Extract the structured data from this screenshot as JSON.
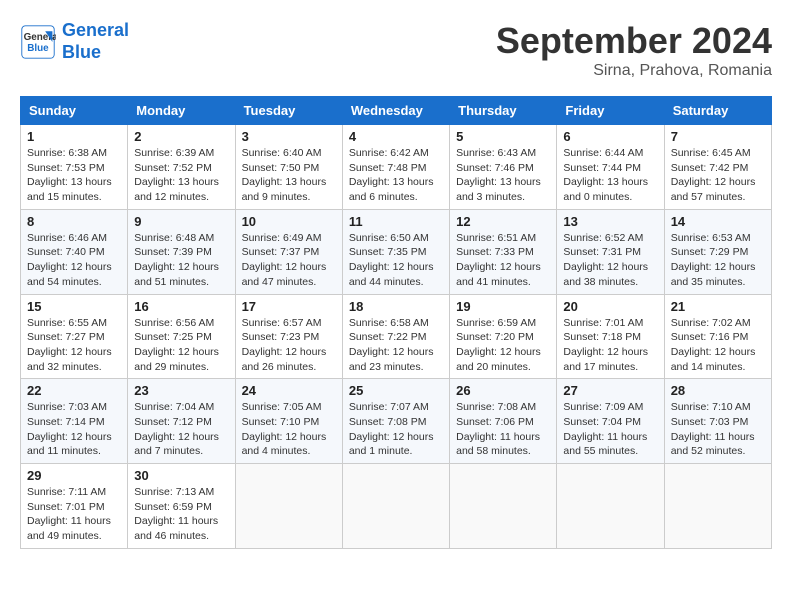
{
  "header": {
    "logo": {
      "line1": "General",
      "line2": "Blue"
    },
    "title": "September 2024",
    "location": "Sirna, Prahova, Romania"
  },
  "days_of_week": [
    "Sunday",
    "Monday",
    "Tuesday",
    "Wednesday",
    "Thursday",
    "Friday",
    "Saturday"
  ],
  "weeks": [
    [
      {
        "day": "1",
        "info": "Sunrise: 6:38 AM\nSunset: 7:53 PM\nDaylight: 13 hours\nand 15 minutes."
      },
      {
        "day": "2",
        "info": "Sunrise: 6:39 AM\nSunset: 7:52 PM\nDaylight: 13 hours\nand 12 minutes."
      },
      {
        "day": "3",
        "info": "Sunrise: 6:40 AM\nSunset: 7:50 PM\nDaylight: 13 hours\nand 9 minutes."
      },
      {
        "day": "4",
        "info": "Sunrise: 6:42 AM\nSunset: 7:48 PM\nDaylight: 13 hours\nand 6 minutes."
      },
      {
        "day": "5",
        "info": "Sunrise: 6:43 AM\nSunset: 7:46 PM\nDaylight: 13 hours\nand 3 minutes."
      },
      {
        "day": "6",
        "info": "Sunrise: 6:44 AM\nSunset: 7:44 PM\nDaylight: 13 hours\nand 0 minutes."
      },
      {
        "day": "7",
        "info": "Sunrise: 6:45 AM\nSunset: 7:42 PM\nDaylight: 12 hours\nand 57 minutes."
      }
    ],
    [
      {
        "day": "8",
        "info": "Sunrise: 6:46 AM\nSunset: 7:40 PM\nDaylight: 12 hours\nand 54 minutes."
      },
      {
        "day": "9",
        "info": "Sunrise: 6:48 AM\nSunset: 7:39 PM\nDaylight: 12 hours\nand 51 minutes."
      },
      {
        "day": "10",
        "info": "Sunrise: 6:49 AM\nSunset: 7:37 PM\nDaylight: 12 hours\nand 47 minutes."
      },
      {
        "day": "11",
        "info": "Sunrise: 6:50 AM\nSunset: 7:35 PM\nDaylight: 12 hours\nand 44 minutes."
      },
      {
        "day": "12",
        "info": "Sunrise: 6:51 AM\nSunset: 7:33 PM\nDaylight: 12 hours\nand 41 minutes."
      },
      {
        "day": "13",
        "info": "Sunrise: 6:52 AM\nSunset: 7:31 PM\nDaylight: 12 hours\nand 38 minutes."
      },
      {
        "day": "14",
        "info": "Sunrise: 6:53 AM\nSunset: 7:29 PM\nDaylight: 12 hours\nand 35 minutes."
      }
    ],
    [
      {
        "day": "15",
        "info": "Sunrise: 6:55 AM\nSunset: 7:27 PM\nDaylight: 12 hours\nand 32 minutes."
      },
      {
        "day": "16",
        "info": "Sunrise: 6:56 AM\nSunset: 7:25 PM\nDaylight: 12 hours\nand 29 minutes."
      },
      {
        "day": "17",
        "info": "Sunrise: 6:57 AM\nSunset: 7:23 PM\nDaylight: 12 hours\nand 26 minutes."
      },
      {
        "day": "18",
        "info": "Sunrise: 6:58 AM\nSunset: 7:22 PM\nDaylight: 12 hours\nand 23 minutes."
      },
      {
        "day": "19",
        "info": "Sunrise: 6:59 AM\nSunset: 7:20 PM\nDaylight: 12 hours\nand 20 minutes."
      },
      {
        "day": "20",
        "info": "Sunrise: 7:01 AM\nSunset: 7:18 PM\nDaylight: 12 hours\nand 17 minutes."
      },
      {
        "day": "21",
        "info": "Sunrise: 7:02 AM\nSunset: 7:16 PM\nDaylight: 12 hours\nand 14 minutes."
      }
    ],
    [
      {
        "day": "22",
        "info": "Sunrise: 7:03 AM\nSunset: 7:14 PM\nDaylight: 12 hours\nand 11 minutes."
      },
      {
        "day": "23",
        "info": "Sunrise: 7:04 AM\nSunset: 7:12 PM\nDaylight: 12 hours\nand 7 minutes."
      },
      {
        "day": "24",
        "info": "Sunrise: 7:05 AM\nSunset: 7:10 PM\nDaylight: 12 hours\nand 4 minutes."
      },
      {
        "day": "25",
        "info": "Sunrise: 7:07 AM\nSunset: 7:08 PM\nDaylight: 12 hours\nand 1 minute."
      },
      {
        "day": "26",
        "info": "Sunrise: 7:08 AM\nSunset: 7:06 PM\nDaylight: 11 hours\nand 58 minutes."
      },
      {
        "day": "27",
        "info": "Sunrise: 7:09 AM\nSunset: 7:04 PM\nDaylight: 11 hours\nand 55 minutes."
      },
      {
        "day": "28",
        "info": "Sunrise: 7:10 AM\nSunset: 7:03 PM\nDaylight: 11 hours\nand 52 minutes."
      }
    ],
    [
      {
        "day": "29",
        "info": "Sunrise: 7:11 AM\nSunset: 7:01 PM\nDaylight: 11 hours\nand 49 minutes."
      },
      {
        "day": "30",
        "info": "Sunrise: 7:13 AM\nSunset: 6:59 PM\nDaylight: 11 hours\nand 46 minutes."
      },
      {
        "day": "",
        "info": ""
      },
      {
        "day": "",
        "info": ""
      },
      {
        "day": "",
        "info": ""
      },
      {
        "day": "",
        "info": ""
      },
      {
        "day": "",
        "info": ""
      }
    ]
  ]
}
